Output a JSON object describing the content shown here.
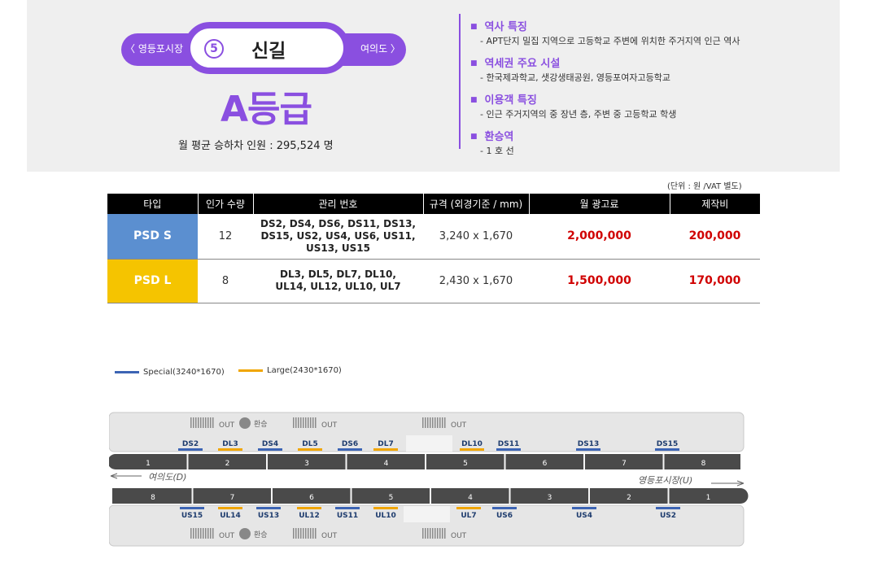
{
  "header": {
    "prev_station": "〈 영등포시장",
    "next_station": "여의도 〉",
    "line_number": "5",
    "station_name": "신길",
    "grade": "A등급",
    "monthly_riders": "월 평균 승하차 인원 :  295,524 명",
    "line_color": "#8a4fe0",
    "info": [
      {
        "title": "역사 특징",
        "desc": "-  APT단지 밀집 지역으로 고등학교 주변에 위치한 주거지역 인근 역사"
      },
      {
        "title": "역세권 주요 시설",
        "desc": "-  한국제과학교, 샛강생태공원, 영등포여자고등학교"
      },
      {
        "title": "이용객 특징",
        "desc": "-  인근 주거지역의 중 장년 층, 주변 중 고등학교 학생"
      },
      {
        "title": "환승역",
        "desc": "-  1 호 선"
      }
    ]
  },
  "table": {
    "unit_note": "(단위 : 원 /VAT 별도)",
    "headers": [
      "타입",
      "인가 수량",
      "관리 번호",
      "규격 (외경기준 / mm)",
      "월 광고료",
      "제작비"
    ],
    "rows": [
      {
        "type": "PSD S",
        "qty": "12",
        "codes_1": "DS2, DS4, DS6, DS11, DS13,",
        "codes_2": "DS15, US2, US4, US6, US11,",
        "codes_3": "US13, US15",
        "size": "3,240 x 1,670",
        "monthly": "2,000,000",
        "production": "200,000",
        "color": "#5b8fd0"
      },
      {
        "type": "PSD L",
        "qty": "8",
        "codes_1": "DL3, DL5, DL7, DL10,",
        "codes_2": "UL14, UL12, UL10, UL7",
        "codes_3": "",
        "size": "2,430 x 1,670",
        "monthly": "1,500,000",
        "production": "170,000",
        "color": "#f5c400"
      }
    ]
  },
  "legend": {
    "special": "Special(3240*1670)",
    "large": "Large(2430*1670)",
    "special_color": "#3c64b4",
    "large_color": "#f0a500"
  },
  "diagram": {
    "top_exits": [
      "OUT",
      "환승",
      "OUT",
      "OUT"
    ],
    "bottom_exits": [
      "OUT",
      "환승",
      "OUT",
      "OUT"
    ],
    "top_ads": [
      {
        "label": "DS2",
        "kind": "S"
      },
      {
        "label": "DL3",
        "kind": "L"
      },
      {
        "label": "DS4",
        "kind": "S"
      },
      {
        "label": "DL5",
        "kind": "L"
      },
      {
        "label": "DS6",
        "kind": "S"
      },
      {
        "label": "DL7",
        "kind": "L"
      },
      {
        "label": "DL10",
        "kind": "L"
      },
      {
        "label": "DS11",
        "kind": "S"
      },
      {
        "label": "DS13",
        "kind": "S"
      },
      {
        "label": "DS15",
        "kind": "S"
      }
    ],
    "top_cars": [
      "1",
      "2",
      "3",
      "4",
      "5",
      "6",
      "7",
      "8"
    ],
    "dir_left": "여의도(D)",
    "dir_right": "영등포시장(U)",
    "bottom_cars": [
      "8",
      "7",
      "6",
      "5",
      "4",
      "3",
      "2",
      "1"
    ],
    "bottom_ads": [
      {
        "label": "US15",
        "kind": "S"
      },
      {
        "label": "UL14",
        "kind": "L"
      },
      {
        "label": "US13",
        "kind": "S"
      },
      {
        "label": "UL12",
        "kind": "L"
      },
      {
        "label": "US11",
        "kind": "S"
      },
      {
        "label": "UL10",
        "kind": "L"
      },
      {
        "label": "UL7",
        "kind": "L"
      },
      {
        "label": "US6",
        "kind": "S"
      },
      {
        "label": "US4",
        "kind": "S"
      },
      {
        "label": "US2",
        "kind": "S"
      }
    ]
  }
}
